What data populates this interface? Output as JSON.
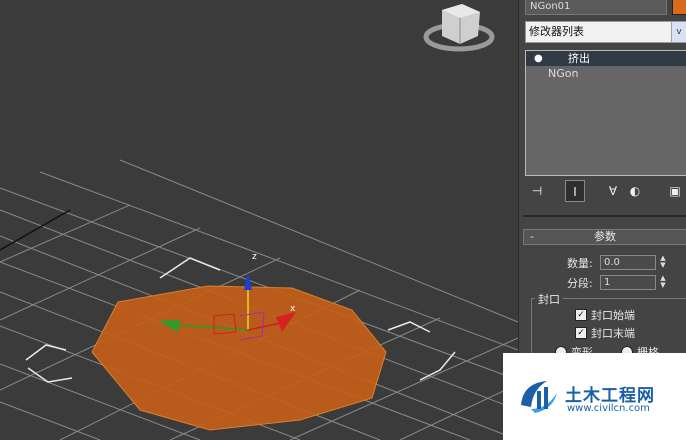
{
  "panel": {
    "object_name": "NGon01",
    "object_color": "#d76a1b",
    "modifier_list": "修改器列表",
    "modifier_list_arrow": "v",
    "stack": [
      {
        "label": "挤出",
        "selected": true
      },
      {
        "label": "NGon",
        "selected": false
      }
    ],
    "params": {
      "title": "参数",
      "collapse": "-",
      "amount_label": "数量:",
      "amount_value": "0.0",
      "segments_label": "分段:",
      "segments_value": "1",
      "cap_group": "封口",
      "cap_start": "封口始端",
      "cap_end": "封口末端",
      "cap_start_checked": true,
      "cap_end_checked": true,
      "morph": "变形",
      "grid": "栅格"
    }
  },
  "viewport": {
    "axis_z": "z",
    "axis_x": "x",
    "shape_color": "#c45e18"
  },
  "watermark": {
    "title": "土木工程网",
    "url": "www.civilcn.com"
  }
}
